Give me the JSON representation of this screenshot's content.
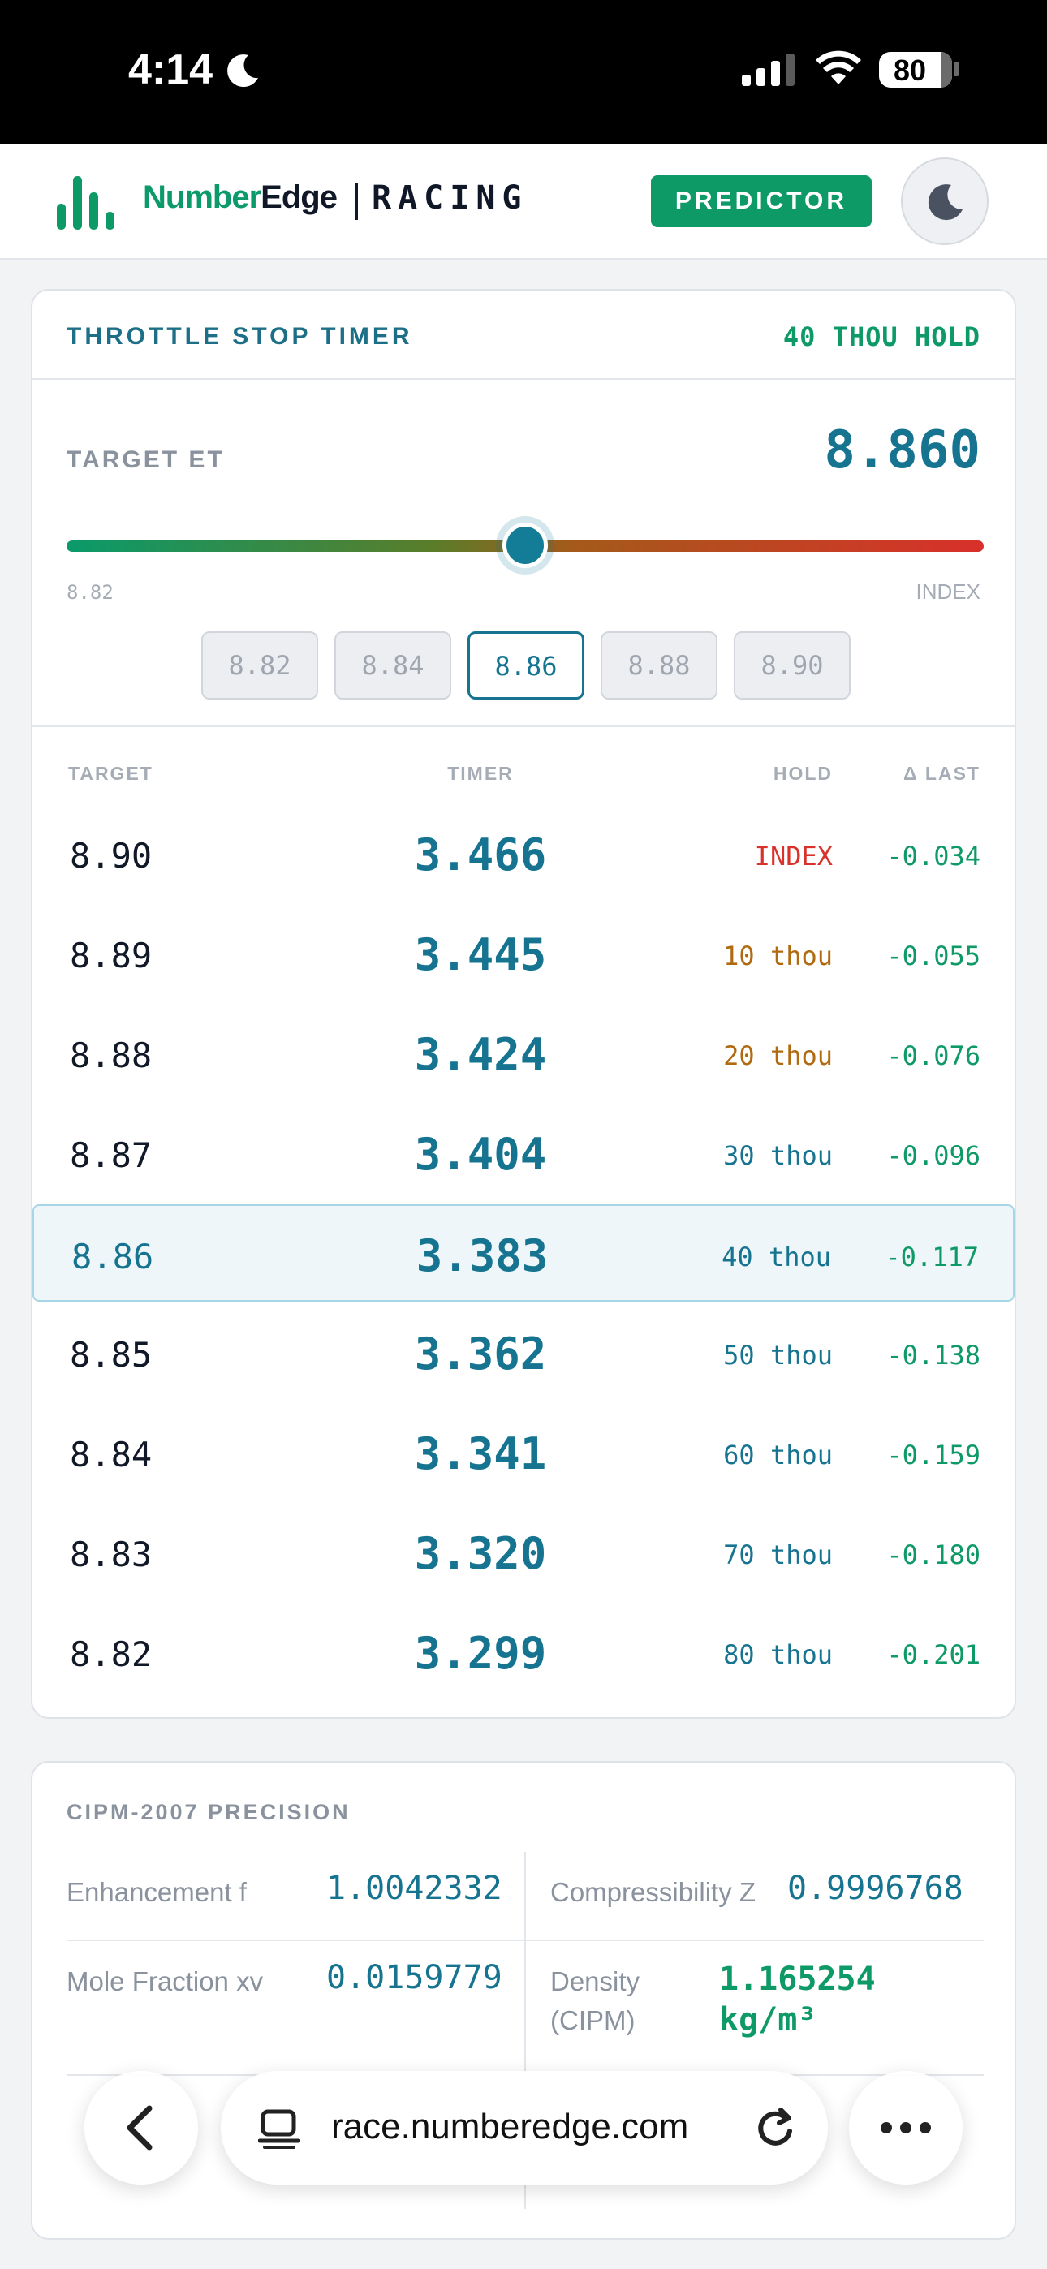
{
  "status": {
    "time": "4:14",
    "battery": "80"
  },
  "brand": {
    "name_a": "Number",
    "name_b": "Edge",
    "section": "RACING",
    "predictor_label": "PREDICTOR"
  },
  "timer_card": {
    "title": "THROTTLE STOP TIMER",
    "mode": "40 THOU HOLD",
    "target_label": "TARGET ET",
    "target_value": "8.860",
    "slider": {
      "min_label": "8.82",
      "max_label": "INDEX",
      "level_fraction": 0.5
    },
    "chips": [
      "8.82",
      "8.84",
      "8.86",
      "8.88",
      "8.90"
    ],
    "active_chip": "8.86",
    "columns": {
      "target": "TARGET",
      "timer": "TIMER",
      "hold": "HOLD",
      "delta": "Δ LAST"
    },
    "rows": [
      {
        "target": "8.90",
        "timer": "3.466",
        "hold": "INDEX",
        "delta": "-0.034",
        "hold_color": "#d9322a"
      },
      {
        "target": "8.89",
        "timer": "3.445",
        "hold": "10 thou",
        "delta": "-0.055",
        "hold_color": "#b06a10"
      },
      {
        "target": "8.88",
        "timer": "3.424",
        "hold": "20 thou",
        "delta": "-0.076",
        "hold_color": "#b06a10"
      },
      {
        "target": "8.87",
        "timer": "3.404",
        "hold": "30 thou",
        "delta": "-0.096",
        "hold_color": "#167491"
      },
      {
        "target": "8.86",
        "timer": "3.383",
        "hold": "40 thou",
        "delta": "-0.117",
        "hold_color": "#167491"
      },
      {
        "target": "8.85",
        "timer": "3.362",
        "hold": "50 thou",
        "delta": "-0.138",
        "hold_color": "#167491"
      },
      {
        "target": "8.84",
        "timer": "3.341",
        "hold": "60 thou",
        "delta": "-0.159",
        "hold_color": "#167491"
      },
      {
        "target": "8.83",
        "timer": "3.320",
        "hold": "70 thou",
        "delta": "-0.180",
        "hold_color": "#167491"
      },
      {
        "target": "8.82",
        "timer": "3.299",
        "hold": "80 thou",
        "delta": "-0.201",
        "hold_color": "#167491"
      }
    ],
    "selected_row": 4
  },
  "cipm_card": {
    "title": "CIPM-2007 PRECISION",
    "metrics": [
      {
        "label": "Enhancement f",
        "value": "1.0042332"
      },
      {
        "label": "Compressibility Z",
        "value": "0.9996768"
      },
      {
        "label": "Mole Fraction xv",
        "value": "0.0159779"
      },
      {
        "label_line1": "Density",
        "label_line2": "(CIPM)",
        "value_line1": "1.165254",
        "value_line2": "kg/m³"
      }
    ]
  },
  "browser": {
    "url": "race.numberedge.com"
  },
  "colors": {
    "brand_green": "#0e9a67",
    "accent_teal": "#167491",
    "index_red": "#d9322a",
    "hold_amber": "#b06a10"
  },
  "icons": {
    "theme": "moon-icon",
    "logo": "bar-chart-icon",
    "back": "chevron-left-icon",
    "tabs": "tab-overview-icon",
    "reload": "reload-icon",
    "more": "more-dots-icon"
  }
}
